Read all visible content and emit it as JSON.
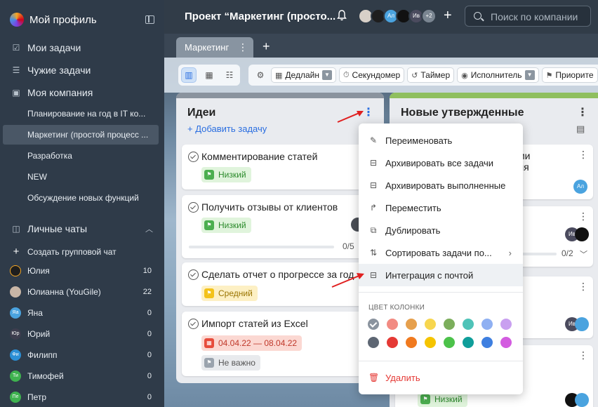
{
  "sidebar": {
    "profile_title": "Мой профиль",
    "nav": [
      {
        "label": "Мои задачи",
        "icon": "my-tasks-icon"
      },
      {
        "label": "Чужие задачи",
        "icon": "others-tasks-icon"
      },
      {
        "label": "Моя компания",
        "icon": "company-icon"
      }
    ],
    "projects": [
      {
        "label": "Планирование на год в IT ко..."
      },
      {
        "label": "Маркетинг (простой процесс ..."
      },
      {
        "label": "Разработка"
      },
      {
        "label": "NEW"
      },
      {
        "label": "Обсуждение новых функций"
      }
    ],
    "chats_header": "Личные чаты",
    "create_chat": "Создать групповой чат",
    "chats": [
      {
        "name": "Юлия",
        "count": "10",
        "initials": "",
        "color": "#1e1e1e"
      },
      {
        "name": "Юлианна (YouGile)",
        "count": "22",
        "initials": "",
        "color": "#c9b6a6"
      },
      {
        "name": "Яна",
        "count": "0",
        "initials": "Яа",
        "color": "#4aa3df"
      },
      {
        "name": "Юрий",
        "count": "0",
        "initials": "Юр",
        "color": "#3d3d4e"
      },
      {
        "name": "Филипп",
        "count": "0",
        "initials": "Фи",
        "color": "#2b8fd6"
      },
      {
        "name": "Тимофей",
        "count": "0",
        "initials": "Ти",
        "color": "#3fb24f"
      },
      {
        "name": "Петр",
        "count": "0",
        "initials": "Пе",
        "color": "#3fb24f"
      }
    ]
  },
  "topbar": {
    "project_title": "Проект “Маркетинг (просто...",
    "avatars": [
      "",
      "",
      "Ал",
      "",
      "Ив",
      "+2"
    ],
    "search_placeholder": "Поиск по компании"
  },
  "tabs": [
    {
      "label": "Маркетинг"
    }
  ],
  "toolbar": {
    "buttons": [
      "Дедлайн",
      "Секундомер",
      "Таймер",
      "Исполнитель",
      "Приорите"
    ]
  },
  "columns": [
    {
      "title": "Идеи",
      "add_label": "+ Добавить задачу",
      "cards": [
        {
          "title": "Комментирование статей",
          "tag": "Низкий"
        },
        {
          "title": "Получить отзывы от клиентов",
          "tag": "Низкий",
          "progress": "0/5"
        },
        {
          "title": "Сделать отчет о прогрессе за год",
          "tag": "Средний"
        },
        {
          "title": "Импорт статей из Excel",
          "deadline": "04.04.22 — 08.04.22",
          "tag": "Не важно"
        }
      ]
    },
    {
      "title": "Новые утвержденные",
      "cards": [
        {
          "title_fragment_1": "ми",
          "title_fragment_2": "ля",
          "avatar": "Ал"
        },
        {
          "avatar": "Ив",
          "progress": "0/2"
        },
        {
          "avatar": "Ив"
        },
        {
          "tag": "Низкий"
        }
      ]
    }
  ],
  "menu": {
    "items": [
      {
        "label": "Переименовать",
        "icon": "pencil-icon"
      },
      {
        "label": "Архивировать все задачи",
        "icon": "archive-icon"
      },
      {
        "label": "Архивировать выполненные",
        "icon": "archive-done-icon"
      },
      {
        "label": "Переместить",
        "icon": "move-icon"
      },
      {
        "label": "Дублировать",
        "icon": "duplicate-icon"
      },
      {
        "label": "Сортировать задачи по...",
        "icon": "sort-icon"
      },
      {
        "label": "Интеграция с почтой",
        "icon": "mail-integration-icon"
      }
    ],
    "color_label": "ЦВЕТ КОЛОНКИ",
    "colors": [
      "#8a939e",
      "#f28b82",
      "#e6a04d",
      "#f7d64f",
      "#7cae5c",
      "#4fc3b8",
      "#8fb0f2",
      "#c9a0f0",
      "#5d6673",
      "#e53935",
      "#f07a1f",
      "#f5c400",
      "#4cc24a",
      "#0f9e9a",
      "#3e7fe0",
      "#d35ce0"
    ],
    "selected_color_index": 0,
    "delete_label": "Удалить"
  }
}
